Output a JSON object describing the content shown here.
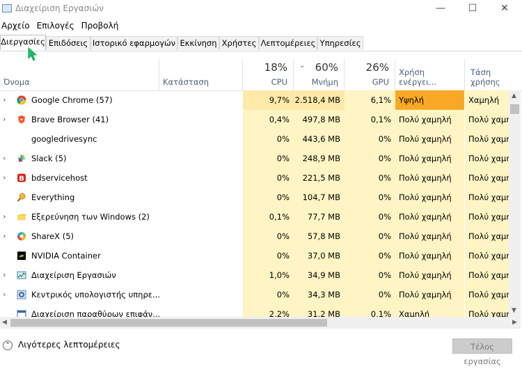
{
  "window": {
    "title": "Διαχείριση Εργασιών",
    "min": "—",
    "max": "☐",
    "close": "✕"
  },
  "menu": [
    "Αρχείο",
    "Επιλογές",
    "Προβολή"
  ],
  "tabs": [
    "Διεργασίες",
    "Επιδόσεις",
    "Ιστορικό εφαρμογών",
    "Εκκίνηση",
    "Χρήστες",
    "Λεπτομέρειες",
    "Υπηρεσίες"
  ],
  "columns": {
    "name": "Όνομα",
    "status": "Κατάσταση",
    "cpu": {
      "pct": "18%",
      "label": "CPU"
    },
    "memory": {
      "pct": "60%",
      "label": "Μνήμη"
    },
    "gpu": {
      "pct": "26%",
      "label": "GPU"
    },
    "energy": "Χρήση ενέργει...",
    "trend": "Τάση χρήσης"
  },
  "rows": [
    {
      "expand": "›",
      "icon": "chrome-icon",
      "name": "Google Chrome (57)",
      "cpu": "9,7%",
      "mem": "2.518,4 MB",
      "gpu": "6,1%",
      "energy": "Υψηλή",
      "trend": "Χαμηλή"
    },
    {
      "expand": "›",
      "icon": "brave-icon",
      "name": "Brave Browser (41)",
      "cpu": "0,4%",
      "mem": "497,8 MB",
      "gpu": "0,1%",
      "energy": "Πολύ χαμηλή",
      "trend": "Πολύ χαμηλή"
    },
    {
      "expand": "",
      "icon": "blank-icon",
      "name": "googledrivesync",
      "cpu": "0%",
      "mem": "443,6 MB",
      "gpu": "0%",
      "energy": "Πολύ χαμηλή",
      "trend": "Πολύ χαμηλή"
    },
    {
      "expand": "›",
      "icon": "slack-icon",
      "name": "Slack (5)",
      "cpu": "0%",
      "mem": "248,9 MB",
      "gpu": "0%",
      "energy": "Πολύ χαμηλή",
      "trend": "Πολύ χαμηλή"
    },
    {
      "expand": "›",
      "icon": "bdservicehost-icon",
      "name": "bdservicehost",
      "cpu": "0%",
      "mem": "221,5 MB",
      "gpu": "0%",
      "energy": "Πολύ χαμηλή",
      "trend": "Πολύ χαμηλή"
    },
    {
      "expand": "",
      "icon": "everything-search-icon",
      "name": "Everything",
      "cpu": "0%",
      "mem": "104,7 MB",
      "gpu": "0%",
      "energy": "Πολύ χαμηλή",
      "trend": "Πολύ χαμηλή"
    },
    {
      "expand": "›",
      "icon": "explorer-folder-icon",
      "name": "Εξερεύνηση των Windows (2)",
      "cpu": "0,1%",
      "mem": "77,7 MB",
      "gpu": "0%",
      "energy": "Πολύ χαμηλή",
      "trend": "Πολύ χαμηλή"
    },
    {
      "expand": "›",
      "icon": "sharex-icon",
      "name": "ShareX (5)",
      "cpu": "0%",
      "mem": "57,8 MB",
      "gpu": "0%",
      "energy": "Πολύ χαμηλή",
      "trend": "Πολύ χαμηλή"
    },
    {
      "expand": "",
      "icon": "nvidia-icon",
      "name": "NVIDIA Container",
      "cpu": "0%",
      "mem": "37,0 MB",
      "gpu": "0%",
      "energy": "Πολύ χαμηλή",
      "trend": "Πολύ χαμηλή"
    },
    {
      "expand": "›",
      "icon": "task-manager-icon",
      "name": "Διαχείριση Εργασιών",
      "cpu": "1,0%",
      "mem": "34,9 MB",
      "gpu": "0%",
      "energy": "Πολύ χαμηλή",
      "trend": "Πολύ χαμηλή"
    },
    {
      "expand": "›",
      "icon": "service-host-gear-icon",
      "name": "Κεντρικός υπολογιστής υπηρε...",
      "cpu": "0%",
      "mem": "34,3 MB",
      "gpu": "0%",
      "energy": "Πολύ χαμηλή",
      "trend": "Πολύ χαμηλή"
    },
    {
      "expand": "",
      "icon": "window-manager-icon",
      "name": "Διαχείριση παραθύρων επιφάν...",
      "cpu": "2,2%",
      "mem": "31,2 MB",
      "gpu": "0,1%",
      "energy": "Χαμηλή",
      "trend": "Πολύ χαμηλή"
    }
  ],
  "footer": {
    "less_details": "Λιγότερες λεπτομέρειες",
    "end_task": "Τέλος εργασίας"
  },
  "colors": {
    "heat_light": "#fff4c4",
    "heat_mid": "#ffe9a8",
    "heat_high": "#f9a825",
    "accent": "#0078d7"
  }
}
